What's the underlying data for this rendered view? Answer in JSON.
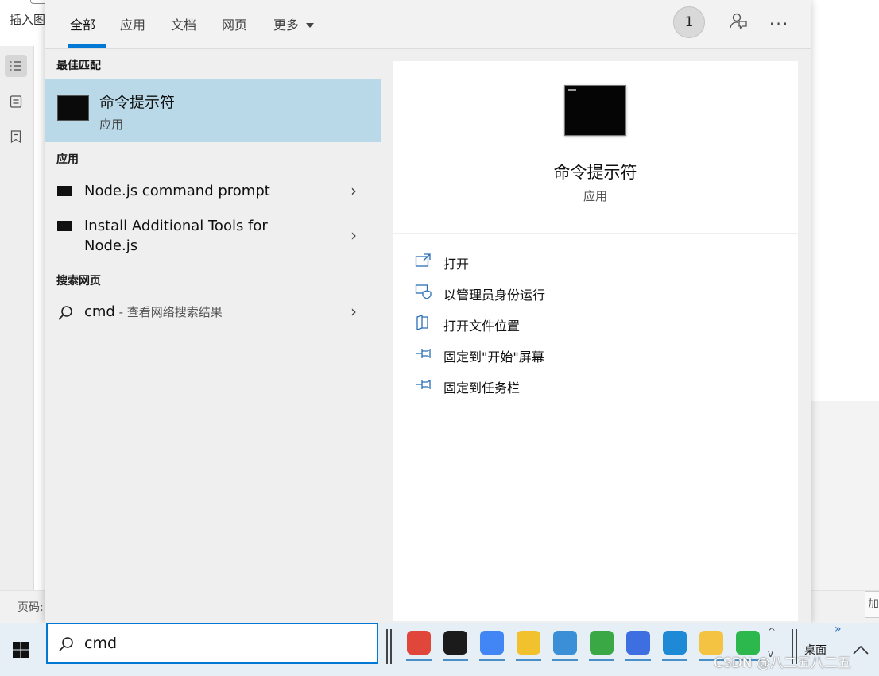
{
  "background_app": {
    "top_label": "插入图",
    "page_label": "页码:",
    "right_box_text": "加"
  },
  "search": {
    "tabs": [
      {
        "label": "全部",
        "active": true
      },
      {
        "label": "应用",
        "active": false
      },
      {
        "label": "文档",
        "active": false
      },
      {
        "label": "网页",
        "active": false
      },
      {
        "label": "更多",
        "active": false,
        "dropdown": true
      }
    ],
    "badge_count": "1",
    "more_icon": "...",
    "sections": {
      "best_match": "最佳匹配",
      "apps": "应用",
      "web": "搜索网页"
    },
    "best_match": {
      "title": "命令提示符",
      "subtitle": "应用",
      "icon": "terminal-icon"
    },
    "app_results": [
      {
        "label": "Node.js command prompt",
        "icon": "terminal-icon"
      },
      {
        "label": "Install Additional Tools for Node.js",
        "icon": "terminal-icon"
      }
    ],
    "web_result": {
      "query": "cmd",
      "suffix": " - 查看网络搜索结果",
      "icon": "search-icon"
    },
    "detail": {
      "title": "命令提示符",
      "subtitle": "应用",
      "actions": [
        {
          "label": "打开",
          "icon": "open-window-icon"
        },
        {
          "label": "以管理员身份运行",
          "icon": "admin-shield-icon"
        },
        {
          "label": "打开文件位置",
          "icon": "file-location-icon"
        },
        {
          "label": "固定到\"开始\"屏幕",
          "icon": "pin-icon"
        },
        {
          "label": "固定到任务栏",
          "icon": "pin-icon"
        }
      ]
    },
    "search_box": {
      "value": "cmd"
    }
  },
  "taskbar": {
    "apps": [
      {
        "name": "app-red-swirl",
        "color": "#e0473a"
      },
      {
        "name": "app-s-green",
        "color": "#1b1b1b"
      },
      {
        "name": "chrome",
        "color": "#4285f4"
      },
      {
        "name": "app-yellow",
        "color": "#f1c22e"
      },
      {
        "name": "app-blue-book",
        "color": "#3b8fd6"
      },
      {
        "name": "app-green-v",
        "color": "#3aa845"
      },
      {
        "name": "wps-writer",
        "color": "#3d6fe0"
      },
      {
        "name": "edge",
        "color": "#1e8ad6"
      },
      {
        "name": "file-explorer",
        "color": "#f5c342"
      },
      {
        "name": "wechat",
        "color": "#2db84d"
      }
    ],
    "desktop_label": "桌面",
    "overflow_arrows": "»",
    "watermark": "CSDN @八二五八二五"
  }
}
